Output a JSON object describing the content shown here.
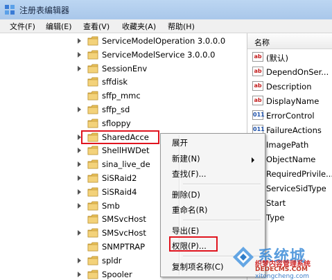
{
  "window": {
    "title": "注册表编辑器"
  },
  "menubar": [
    "文件(F)",
    "编辑(E)",
    "查看(V)",
    "收藏夹(A)",
    "帮助(H)"
  ],
  "tree": {
    "items": [
      {
        "label": "ServiceModelOperation 3.0.0.0",
        "expandable": true
      },
      {
        "label": "ServiceModelService 3.0.0.0",
        "expandable": true
      },
      {
        "label": "SessionEnv",
        "expandable": true
      },
      {
        "label": "sffdisk",
        "expandable": false
      },
      {
        "label": "sffp_mmc",
        "expandable": false
      },
      {
        "label": "sffp_sd",
        "expandable": true
      },
      {
        "label": "sfloppy",
        "expandable": false
      },
      {
        "label": "SharedAcce",
        "expandable": true,
        "selected": true
      },
      {
        "label": "ShellHWDet",
        "expandable": true
      },
      {
        "label": "sina_live_de",
        "expandable": true
      },
      {
        "label": "SiSRaid2",
        "expandable": true
      },
      {
        "label": "SiSRaid4",
        "expandable": true
      },
      {
        "label": "Smb",
        "expandable": true
      },
      {
        "label": "SMSvcHost",
        "expandable": false
      },
      {
        "label": "SMSvcHost",
        "expandable": true
      },
      {
        "label": "SNMPTRAP",
        "expandable": false
      },
      {
        "label": "spldr",
        "expandable": true
      },
      {
        "label": "Spooler",
        "expandable": true
      }
    ]
  },
  "values": {
    "header": "名称",
    "items": [
      {
        "icon": "ab",
        "name": "(默认)"
      },
      {
        "icon": "ab",
        "name": "DependOnSer..."
      },
      {
        "icon": "ab",
        "name": "Description"
      },
      {
        "icon": "ab",
        "name": "DisplayName"
      },
      {
        "icon": "bin",
        "name": "ErrorControl"
      },
      {
        "icon": "bin",
        "name": "FailureActions"
      },
      {
        "icon": "none",
        "name": "ImagePath"
      },
      {
        "icon": "none",
        "name": "ObjectName"
      },
      {
        "icon": "none",
        "name": "RequiredPrivile..."
      },
      {
        "icon": "none",
        "name": "ServiceSidType"
      },
      {
        "icon": "none",
        "name": "Start"
      },
      {
        "icon": "none",
        "name": "Type"
      }
    ]
  },
  "context_menu": {
    "expand": "展开",
    "new": "新建(N)",
    "find": "查找(F)...",
    "delete": "删除(D)",
    "rename": "重命名(R)",
    "export": "导出(E)",
    "permissions": "权限(P)...",
    "copy_key_name": "复制项名称(C)"
  },
  "watermark": {
    "brand": "系统城",
    "subtitle": "织梦内容管理系统",
    "url1": "DEDECMS.COM",
    "url2": "xitongcheng.com"
  },
  "colors": {
    "highlight": "#e0141e",
    "titlebar": "#bcd6f2",
    "folder": "#e8c15a"
  }
}
